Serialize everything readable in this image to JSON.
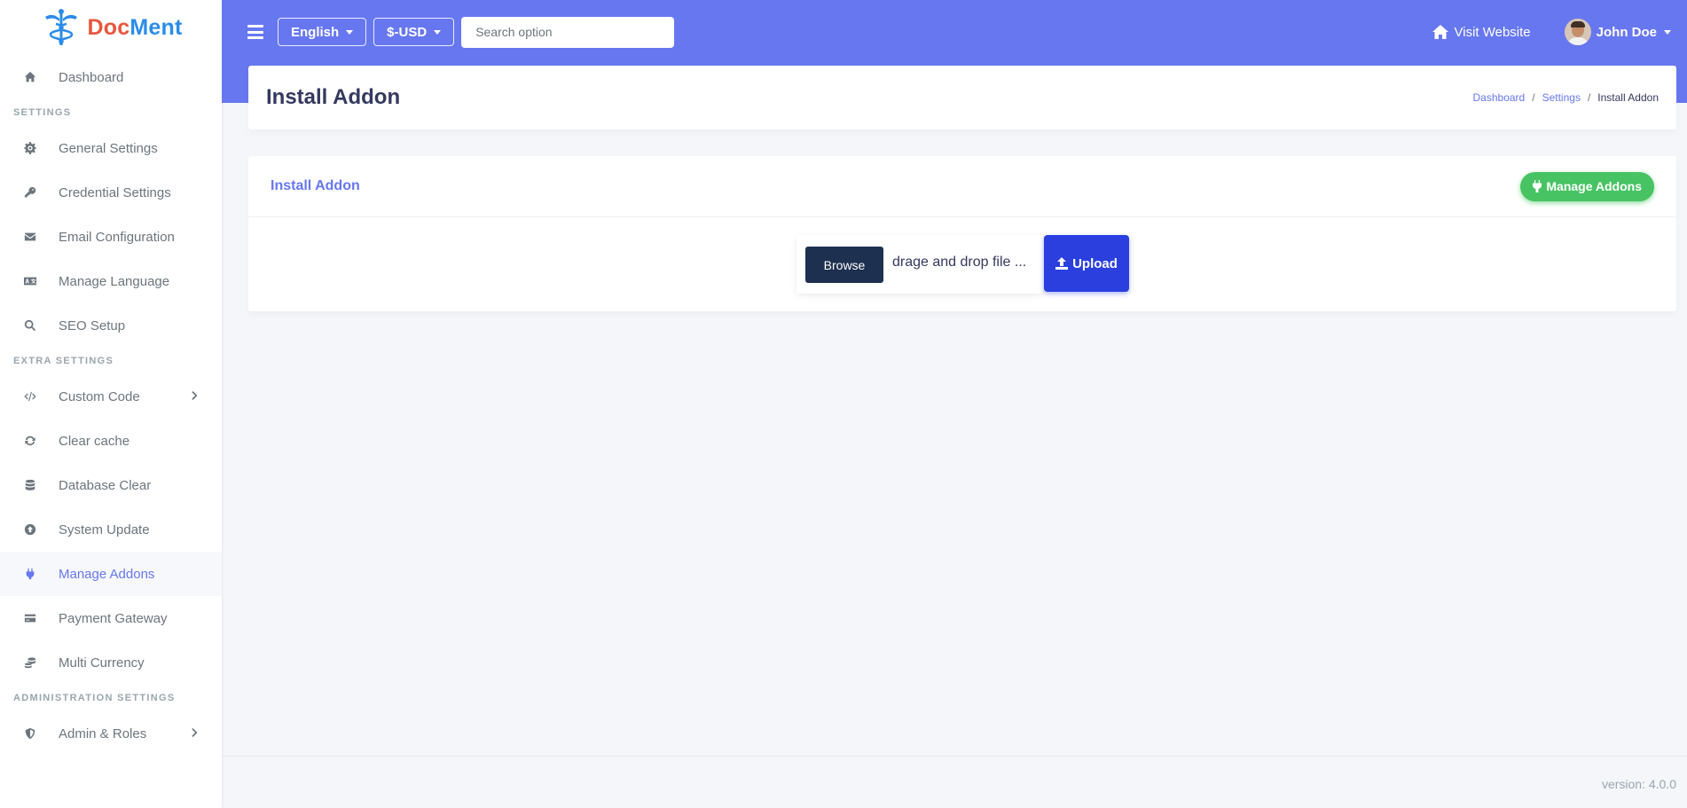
{
  "brand": {
    "part1": "Doc",
    "part2": "Ment",
    "icon": "caduceus-icon"
  },
  "sidebar": {
    "sections": [
      {
        "header": "",
        "items": [
          {
            "label": "Dashboard",
            "icon": "home-icon"
          }
        ]
      },
      {
        "header": "SETTINGS",
        "items": [
          {
            "label": "General Settings",
            "icon": "gear-icon"
          },
          {
            "label": "Credential Settings",
            "icon": "key-icon"
          },
          {
            "label": "Email Configuration",
            "icon": "envelope-icon"
          },
          {
            "label": "Manage Language",
            "icon": "language-icon"
          },
          {
            "label": "SEO Setup",
            "icon": "search-icon"
          }
        ]
      },
      {
        "header": "EXTRA SETTINGS",
        "items": [
          {
            "label": "Custom Code",
            "icon": "code-icon",
            "has_submenu": true
          },
          {
            "label": "Clear cache",
            "icon": "refresh-icon"
          },
          {
            "label": "Database Clear",
            "icon": "database-icon"
          },
          {
            "label": "System Update",
            "icon": "upload-circle-icon"
          },
          {
            "label": "Manage Addons",
            "icon": "plug-icon",
            "active": true
          },
          {
            "label": "Payment Gateway",
            "icon": "credit-card-icon"
          },
          {
            "label": "Multi Currency",
            "icon": "coins-icon"
          }
        ]
      },
      {
        "header": "ADMINISTRATION SETTINGS",
        "items": [
          {
            "label": "Admin & Roles",
            "icon": "shield-icon",
            "has_submenu": true
          }
        ]
      }
    ]
  },
  "navbar": {
    "language": "English",
    "currency": "$-USD",
    "search_placeholder": "Search option",
    "visit_website": "Visit Website",
    "user_name": "John Doe"
  },
  "header": {
    "title": "Install Addon",
    "breadcrumb": [
      "Dashboard",
      "Settings",
      "Install Addon"
    ]
  },
  "card": {
    "title": "Install Addon",
    "manage_button": "Manage Addons",
    "browse_label": "Browse",
    "file_label": "drage and drop file ...",
    "upload_label": "Upload"
  },
  "footer": {
    "version": "version: 4.0.0"
  },
  "colors": {
    "primary": "#6777ef",
    "success": "#47c363",
    "upload": "#2a3fde",
    "browse": "#1e3050",
    "brand_red": "#e8573f",
    "brand_blue": "#2a8ce8"
  }
}
